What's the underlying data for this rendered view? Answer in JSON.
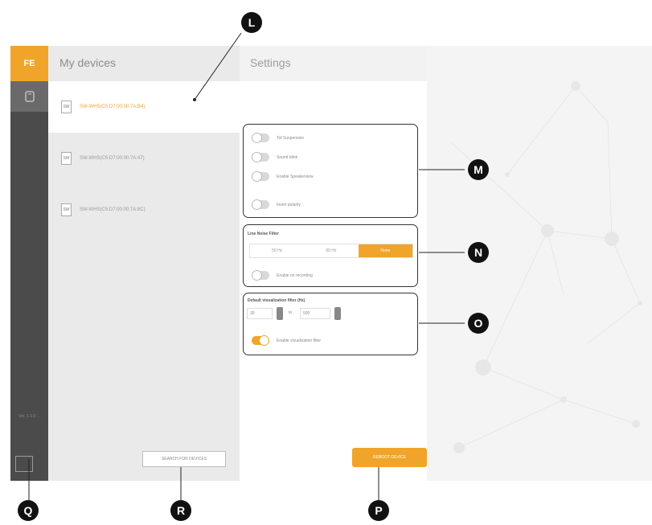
{
  "app": {
    "logo_text": "FE",
    "version_text": "Ver. 1.0.0 ...",
    "info_icon": "info-icon",
    "colors": {
      "accent": "#f0a52a",
      "sidebar": "#4b4b4b",
      "device_list_bg": "#eaeaea"
    }
  },
  "devices": {
    "title": "My devices",
    "items": [
      {
        "name": "SW-WHS(C5:D7:00:00:7A:B4)",
        "icon_text": "SW",
        "selected": true
      },
      {
        "name": "SW-WHS(C5:D7:00:00:7A:47)",
        "icon_text": "SW",
        "selected": false
      },
      {
        "name": "SW-WHS(C5:D7:00:00:7A:8C)",
        "icon_text": "SW",
        "selected": false
      }
    ],
    "search_button": "SEARCH FOR DEVICES"
  },
  "settings": {
    "title": "Settings",
    "toggles": [
      {
        "label": "Tof Suspension",
        "on": false
      },
      {
        "label": "Sound blink",
        "on": false
      },
      {
        "label": "Enable Speakerview",
        "on": false
      },
      {
        "label": "Invert polarity",
        "on": false
      }
    ],
    "line_noise": {
      "title": "Line Noise Filter",
      "options": [
        "50 Hz",
        "60 Hz",
        "None"
      ],
      "active_index": 2,
      "toggle_label": "Enable on recording",
      "toggle_on": false
    },
    "vis_filter": {
      "title": "Default visualization filter (Hz)",
      "low": "30",
      "to_label": "to",
      "high": "500",
      "toggle_label": "Enable visualization filter",
      "toggle_on": true
    },
    "reboot_button": "REBOOT DEVICE"
  },
  "callouts": [
    "L",
    "M",
    "N",
    "O",
    "P",
    "Q",
    "R"
  ]
}
